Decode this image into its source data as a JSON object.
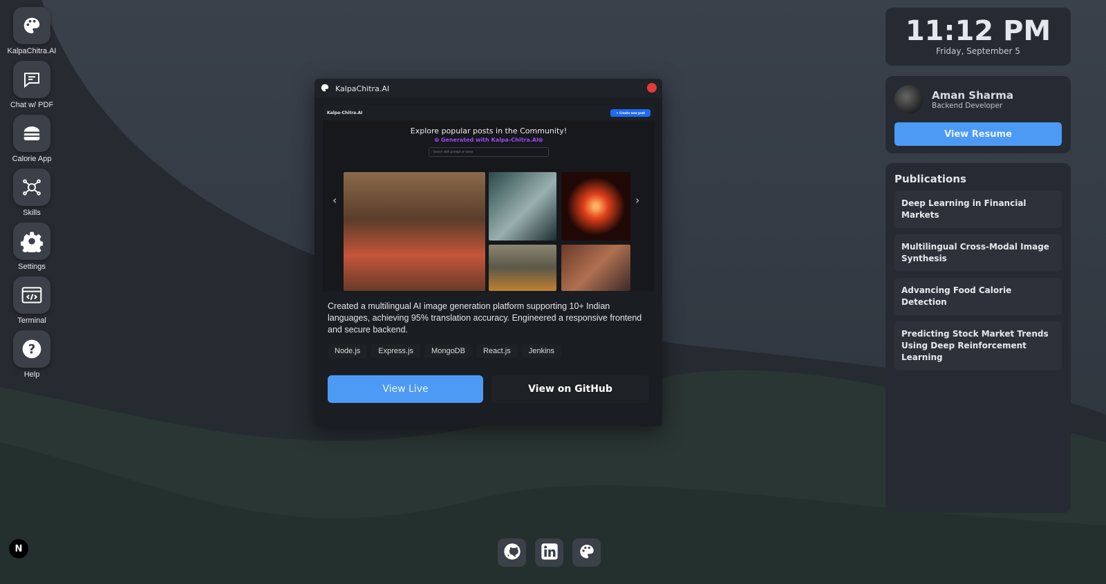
{
  "dock": [
    {
      "label": "KalpaChitra.AI",
      "icon": "palette-icon"
    },
    {
      "label": "Chat w/ PDF",
      "icon": "chat-icon"
    },
    {
      "label": "Calorie App",
      "icon": "burger-icon"
    },
    {
      "label": "Skills",
      "icon": "network-icon"
    },
    {
      "label": "Settings",
      "icon": "gear-icon"
    },
    {
      "label": "Terminal",
      "icon": "terminal-icon"
    },
    {
      "label": "Help",
      "icon": "help-icon"
    }
  ],
  "window": {
    "title": "KalpaChitra.AI",
    "preview": {
      "brand": "Kalpa-Chitra.AI",
      "create_button": "+ Create new post",
      "heading": "Explore popular posts in the Community!",
      "subheading": "⦾ Generated with Kalpa-Chitra.AI⦾",
      "search_placeholder": "Search with prompt or name"
    },
    "description": "Created a multilingual AI image generation platform supporting 10+ Indian languages, achieving 95% translation accuracy. Engineered a responsive frontend and secure backend.",
    "tags": [
      "Node.js",
      "Express.js",
      "MongoDB",
      "React.js",
      "Jenkins"
    ],
    "view_live": "View Live",
    "view_github": "View on GitHub"
  },
  "clock": {
    "time": "11:12 PM",
    "date": "Friday, September 5"
  },
  "profile": {
    "name": "Aman Sharma",
    "role": "Backend Developer",
    "resume_button": "View Resume"
  },
  "publications": {
    "title": "Publications",
    "items": [
      "Deep Learning in Financial Markets",
      "Multilingual Cross-Modal Image Synthesis",
      "Advancing Food Calorie Detection",
      "Predicting Stock Market Trends Using Deep Reinforcement Learning"
    ]
  },
  "badge": "N",
  "colors": {
    "accent": "#4d9af5",
    "close": "#e5393b",
    "purple": "#9a4cf0"
  }
}
